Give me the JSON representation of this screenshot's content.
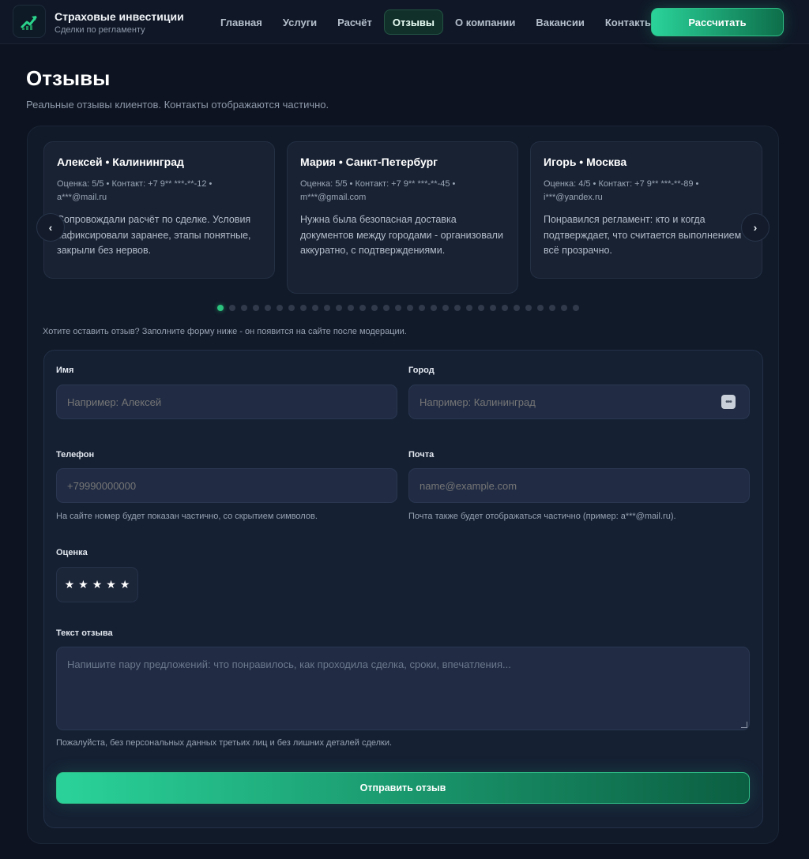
{
  "header": {
    "brand_title": "Страховые инвестиции",
    "brand_subtitle": "Сделки по регламенту",
    "logo_icon": "growth-chart-icon",
    "nav": [
      {
        "label": "Главная",
        "active": false
      },
      {
        "label": "Услуги",
        "active": false
      },
      {
        "label": "Расчёт",
        "active": false
      },
      {
        "label": "Отзывы",
        "active": true
      },
      {
        "label": "О компании",
        "active": false
      },
      {
        "label": "Вакансии",
        "active": false
      },
      {
        "label": "Контакты",
        "active": false
      }
    ],
    "cta_label": "Рассчитать"
  },
  "page": {
    "title": "Отзывы",
    "subtitle": "Реальные отзывы клиентов. Контакты отображаются частично."
  },
  "reviews": [
    {
      "title": "Алексей • Калининград",
      "meta": "Оценка: 5/5 • Контакт: +7 9** ***-**-12 • a***@mail.ru",
      "text": "Сопровождали расчёт по сделке. Условия зафиксировали заранее, этапы понятные, закрыли без нервов."
    },
    {
      "title": "Мария • Санкт-Петербург",
      "meta": "Оценка: 5/5 • Контакт: +7 9** ***-**-45 • m***@gmail.com",
      "text": "Нужна была безопасная доставка документов между городами - организовали аккуратно, с подтверждениями."
    },
    {
      "title": "Игорь • Москва",
      "meta": "Оценка: 4/5 • Контакт: +7 9** ***-**-89 • i***@yandex.ru",
      "text": "Понравился регламент: кто и когда подтверждает, что считается выполнением - всё прозрачно."
    }
  ],
  "carousel": {
    "prev_icon": "chevron-left-icon",
    "next_icon": "chevron-right-icon",
    "prev_glyph": "‹",
    "next_glyph": "›",
    "total_dots": 31,
    "active_dot": 0
  },
  "invite": "Хотите оставить отзыв? Заполните форму ниже - он появится на сайте после модерации.",
  "form": {
    "name_label": "Имя",
    "name_placeholder": "Например: Алексей",
    "city_label": "Город",
    "city_placeholder": "Например: Калининград",
    "city_autofill_icon": "more-dots-icon",
    "phone_label": "Телефон",
    "phone_placeholder": "+79990000000",
    "phone_hint": "На сайте номер будет показан частично, со скрытием символов.",
    "email_label": "Почта",
    "email_placeholder": "name@example.com",
    "email_hint": "Почта также будет отображаться частично (пример: a***@mail.ru).",
    "rating_label": "Оценка",
    "rating_value": 5,
    "star_glyph": "★",
    "text_label": "Текст отзыва",
    "text_placeholder": "Напишите пару предложений: что понравилось, как проходила сделка, сроки, впечатления...",
    "text_hint": "Пожалуйста, без персональных данных третьих лиц и без лишних деталей сделки.",
    "submit_label": "Отправить отзыв"
  },
  "colors": {
    "background": "#0d1320",
    "accent": "#2ad39a",
    "accent_dark": "#0b5e41",
    "active_dot": "#2bc37d"
  }
}
